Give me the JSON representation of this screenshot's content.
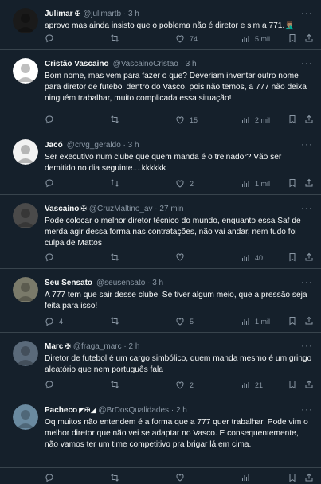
{
  "tweets": [
    {
      "name": "Julimar",
      "badge": "✠",
      "handle": "@julimartb · 3 h",
      "text": "aprovo mas ainda insisto que o poblema não é diretor e sim a 771.🤦🏽‍♂️",
      "replies": "",
      "retweets": "",
      "likes": "74",
      "views": "5 mil",
      "avatar_color": "#1a1a1a"
    },
    {
      "name": "Cristão Vascaino",
      "badge": "",
      "handle": "@VascainoCristao · 3 h",
      "text": "Bom nome, mas vem para fazer o que? Deveriam inventar outro nome para diretor de futebol dentro do Vasco, pois não temos, a 777 não deixa ninguém trabalhar, muito complicada essa situação!",
      "replies": "",
      "retweets": "",
      "likes": "15",
      "views": "2 mil",
      "avatar_color": "#ffffff"
    },
    {
      "name": "Jacó",
      "badge": "",
      "handle": "@crvg_geraldo · 3 h",
      "text": "Ser executivo num clube que quem manda é o treinador? Vão ser demitido no dia seguinte....kkkkkk",
      "replies": "",
      "retweets": "",
      "likes": "2",
      "views": "1 mil",
      "avatar_color": "#f2f2f2"
    },
    {
      "name": "Vascaíno",
      "badge": "✠",
      "handle": "@CruzMaltino_av · 27 min",
      "text": "Pode colocar o melhor diretor técnico do mundo, enquanto essa Saf de merda agir dessa forma nas contratações, não vai andar, nem tudo foi culpa de Mattos",
      "replies": "",
      "retweets": "",
      "likes": "",
      "views": "40",
      "avatar_color": "#4a4a4a"
    },
    {
      "name": "Seu Sensato",
      "badge": "",
      "handle": "@seusensato · 3 h",
      "text": "A 777 tem que sair desse clube! Se tiver algum meio, que a pressão seja feita para isso!",
      "replies": "4",
      "retweets": "",
      "likes": "5",
      "views": "1 mil",
      "avatar_color": "#7a7a6a"
    },
    {
      "name": "Marc",
      "badge": "✠",
      "handle": "@fraga_marc · 2 h",
      "text": "Diretor de futebol é um cargo simbólico, quem manda mesmo é um gringo aleatório que nem português fala",
      "replies": "",
      "retweets": "",
      "likes": "2",
      "views": "21",
      "avatar_color": "#5a6a7a"
    },
    {
      "name": "Pacheco",
      "badge": "◤✠◢",
      "handle": "@BrDosQualidades · 2 h",
      "text": "Oq muitos não entendem é a forma que a 777 quer trabalhar. Pode vim o melhor diretor que não vei se adaptar no Vasco. E consequentemente, não vamos ter um time competitivo pra brigar lá em cima.",
      "replies": "",
      "retweets": "",
      "likes": "",
      "views": "",
      "avatar_color": "#6a8aa0"
    }
  ],
  "icons": {
    "reply": "reply-icon",
    "retweet": "retweet-icon",
    "like": "heart-icon",
    "views": "views-icon",
    "bookmark": "bookmark-icon",
    "share": "share-icon",
    "more": "more-icon"
  },
  "more_glyph": "···"
}
